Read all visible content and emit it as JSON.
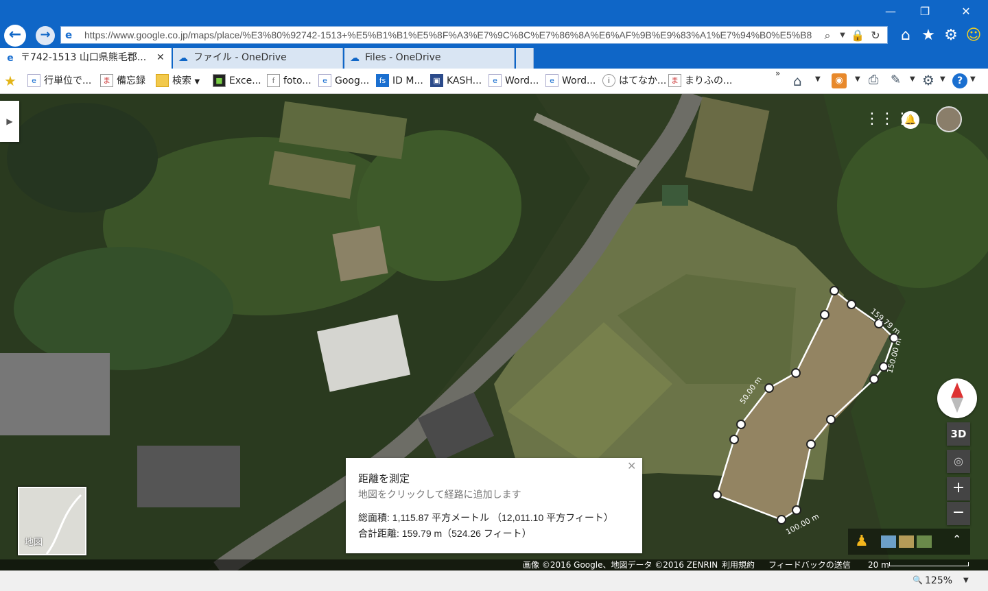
{
  "browser": {
    "url": "https://www.google.co.jp/maps/place/%E3%80%92742-1513+%E5%B1%B1%E5%8F%A3%E7%9C%8C%E7%86%8A%E6%AF%9B%E9%83%A1%E7%94%B0%E5%B8",
    "tabs": [
      {
        "label": "〒742-1513 山口県熊毛郡...",
        "active": true
      },
      {
        "label": "ファイル - OneDrive",
        "active": false
      },
      {
        "label": "Files - OneDrive",
        "active": false
      }
    ],
    "favorites": [
      {
        "label": "行単位で...",
        "icon": "ie-icon"
      },
      {
        "label": "備忘録",
        "icon": "ma-icon"
      },
      {
        "label": "検索",
        "icon": "folder-icon"
      },
      {
        "label": "Exce...",
        "icon": "excel-icon"
      },
      {
        "label": "foto...",
        "icon": "page-icon"
      },
      {
        "label": "Goog...",
        "icon": "ie-icon"
      },
      {
        "label": "ID M...",
        "icon": "fs-icon"
      },
      {
        "label": "KASH...",
        "icon": "kash-icon"
      },
      {
        "label": "Word...",
        "icon": "ie-icon"
      },
      {
        "label": "Word...",
        "icon": "ie-icon"
      },
      {
        "label": "はてなか...",
        "icon": "hatena-icon"
      },
      {
        "label": "まりふの...",
        "icon": "ma-icon"
      }
    ],
    "zoom": "125%"
  },
  "measure": {
    "title": "距離を測定",
    "hint": "地図をクリックして経路に追加します",
    "area": "総面積: 1,115.87 平方メートル （12,011.10 平方フィート）",
    "distance": "合計距離: 159.79 m（524.26 フィート）"
  },
  "map": {
    "labels": {
      "seg1": "159.79 m",
      "seg2": "150.00 m",
      "seg3": "50.00 m",
      "seg4": "100.00 m"
    },
    "minimap_label": "地図",
    "button_3d": "3D",
    "zoom_in": "+",
    "zoom_out": "−"
  },
  "footer": {
    "imagery": "画像 ©2016 Google、地図データ ©2016 ZENRIN",
    "terms": "利用規約",
    "feedback": "フィードバックの送信",
    "scale": "20 m"
  },
  "colors": {
    "chrome": "#0f66c7",
    "measure_line": "#ffffff"
  }
}
